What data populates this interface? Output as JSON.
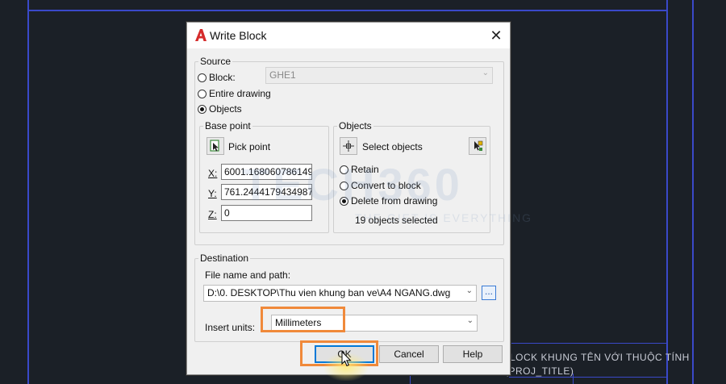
{
  "dialog": {
    "title": "Write Block",
    "close_glyph": "✕",
    "app_icon": "autocad-a-icon"
  },
  "source": {
    "legend": "Source",
    "block_label": "Block:",
    "block_value": "GHE1",
    "entire_drawing_label": "Entire drawing",
    "objects_label": "Objects",
    "selected": "objects"
  },
  "base_point": {
    "legend": "Base point",
    "pick_point_label": "Pick point",
    "x_label": "X:",
    "x_value": "6001.168060786149",
    "y_label": "Y:",
    "y_value": "761.2444179434987",
    "z_label": "Z:",
    "z_value": "0"
  },
  "objects": {
    "legend": "Objects",
    "select_objects_label": "Select objects",
    "retain_label": "Retain",
    "convert_label": "Convert to block",
    "delete_label": "Delete from drawing",
    "selected_option": "delete",
    "status": "19 objects selected"
  },
  "destination": {
    "legend": "Destination",
    "file_label": "File name and path:",
    "file_value": "D:\\0. DESKTOP\\Thu vien khung ban ve\\A4 NGANG.dwg",
    "browse_label": "...",
    "units_label": "Insert units:",
    "units_value": "Millimeters"
  },
  "buttons": {
    "ok": "OK",
    "cancel": "Cancel",
    "help": "Help"
  },
  "background": {
    "title_line1": "LOCK KHUNG TÊN VỚI THUỘC TÍNH",
    "title_line2": "(PROJ_TITLE)",
    "line_color": "#3a49c9"
  },
  "watermark": {
    "text": "TECH360",
    "sub": "THE GIET IS EVERYTHING"
  },
  "colors": {
    "highlight": "#f0893a",
    "accent": "#0078d7"
  }
}
